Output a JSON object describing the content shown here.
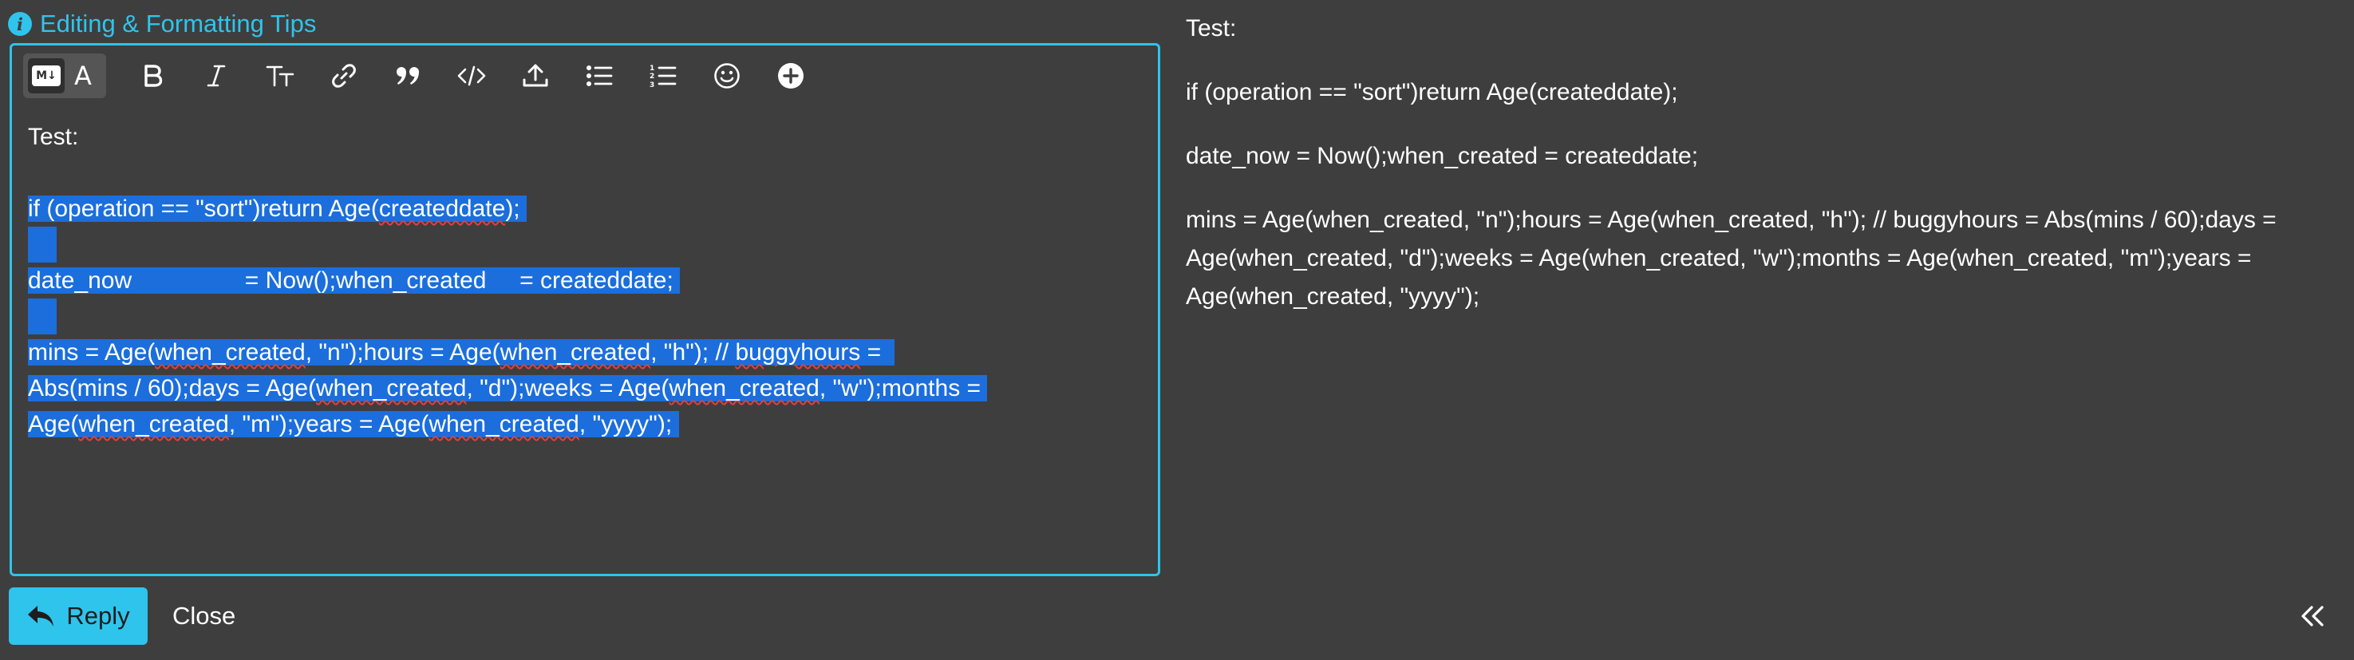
{
  "tips": {
    "label": "Editing & Formatting Tips",
    "info_glyph": "i",
    "icon": "info-icon",
    "color": "#2fc4ec"
  },
  "toolbar": {
    "markdown_badge": "M↓",
    "rich_text_letter": "A",
    "buttons": [
      "markdown-mode-icon",
      "rich-text-mode-icon",
      "bold-icon",
      "italic-icon",
      "text-size-icon",
      "link-icon",
      "quote-icon",
      "code-icon",
      "upload-icon",
      "bullet-list-icon",
      "numbered-list-icon",
      "emoji-icon",
      "add-icon"
    ]
  },
  "editor": {
    "line1": "Test:",
    "line2_pre": "if (operation == \"sort\")return Age(",
    "line2_word": "createddate",
    "line2_post": ");",
    "line3_word1": "date_now",
    "line3_mid1": " = Now();",
    "line3_word2": "when_created",
    "line3_mid2": " = ",
    "line3_word3": "createddate",
    "line3_post": ";",
    "line4_a": "mins = Age(",
    "line4_b": "when_created",
    "line4_c": ", \"n\");hours = Age(",
    "line4_d": "when_created",
    "line4_e": ", \"h\"); // ",
    "line4_f": "buggyhours",
    "line4_g": " =",
    "line5_a": "Abs(mins / 60);days = Age(",
    "line5_b": "when_created",
    "line5_c": ", \"d\");weeks = Age(",
    "line5_d": "when_created",
    "line5_e": ", \"w\");months =",
    "line6_a": "Age(",
    "line6_b": "when_created",
    "line6_c": ", \"m\");years = Age(",
    "line6_d": "when_created",
    "line6_e": ", \"yyyy\");",
    "selection_color": "#1b6edc",
    "border_color": "#2fc4ec"
  },
  "preview": {
    "p1": "Test:",
    "p2": "if (operation == \"sort\")return Age(createddate);",
    "p3": "date_now = Now();when_created = createddate;",
    "p4": "mins = Age(when_created, \"n\");hours = Age(when_created, \"h\"); // buggyhours = Abs(mins / 60);days = Age(when_created, \"d\");weeks = Age(when_created, \"w\");months = Age(when_created, \"m\");years = Age(when_created, \"yyyy\");"
  },
  "footer": {
    "reply_label": "Reply",
    "close_label": "Close",
    "reply_icon": "reply-arrow-icon",
    "collapse_icon": "double-chevron-left-icon",
    "accent": "#2fc4ec"
  },
  "colors": {
    "background": "#3e3e3e",
    "text": "#ffffff"
  }
}
